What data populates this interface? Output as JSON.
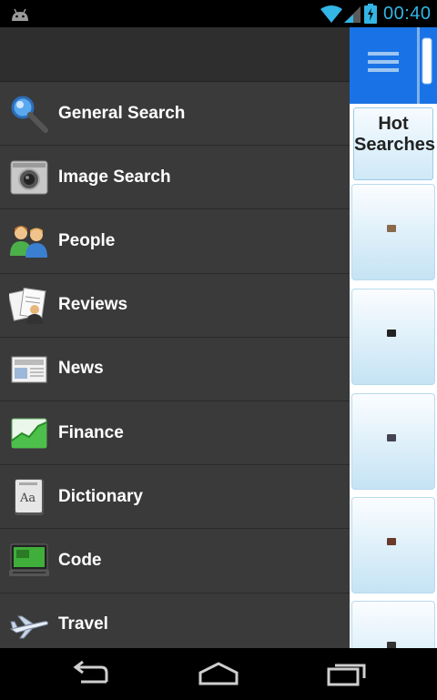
{
  "status_bar": {
    "time": "00:40"
  },
  "drawer": {
    "items": [
      {
        "label": "General Search",
        "icon": "magnifier-icon"
      },
      {
        "label": "Image Search",
        "icon": "camera-icon"
      },
      {
        "label": "People",
        "icon": "people-icon"
      },
      {
        "label": "Reviews",
        "icon": "reviews-icon"
      },
      {
        "label": "News",
        "icon": "newspaper-icon"
      },
      {
        "label": "Finance",
        "icon": "finance-chart-icon"
      },
      {
        "label": "Dictionary",
        "icon": "dictionary-book-icon"
      },
      {
        "label": "Code",
        "icon": "laptop-code-icon"
      },
      {
        "label": "Travel",
        "icon": "airplane-icon"
      }
    ]
  },
  "side_panel": {
    "hot_searches_label": "Hot Searches",
    "accent_color": "#1a73e6"
  },
  "colors": {
    "status_accent": "#33b5e5",
    "drawer_bg": "#3a3a3a"
  }
}
